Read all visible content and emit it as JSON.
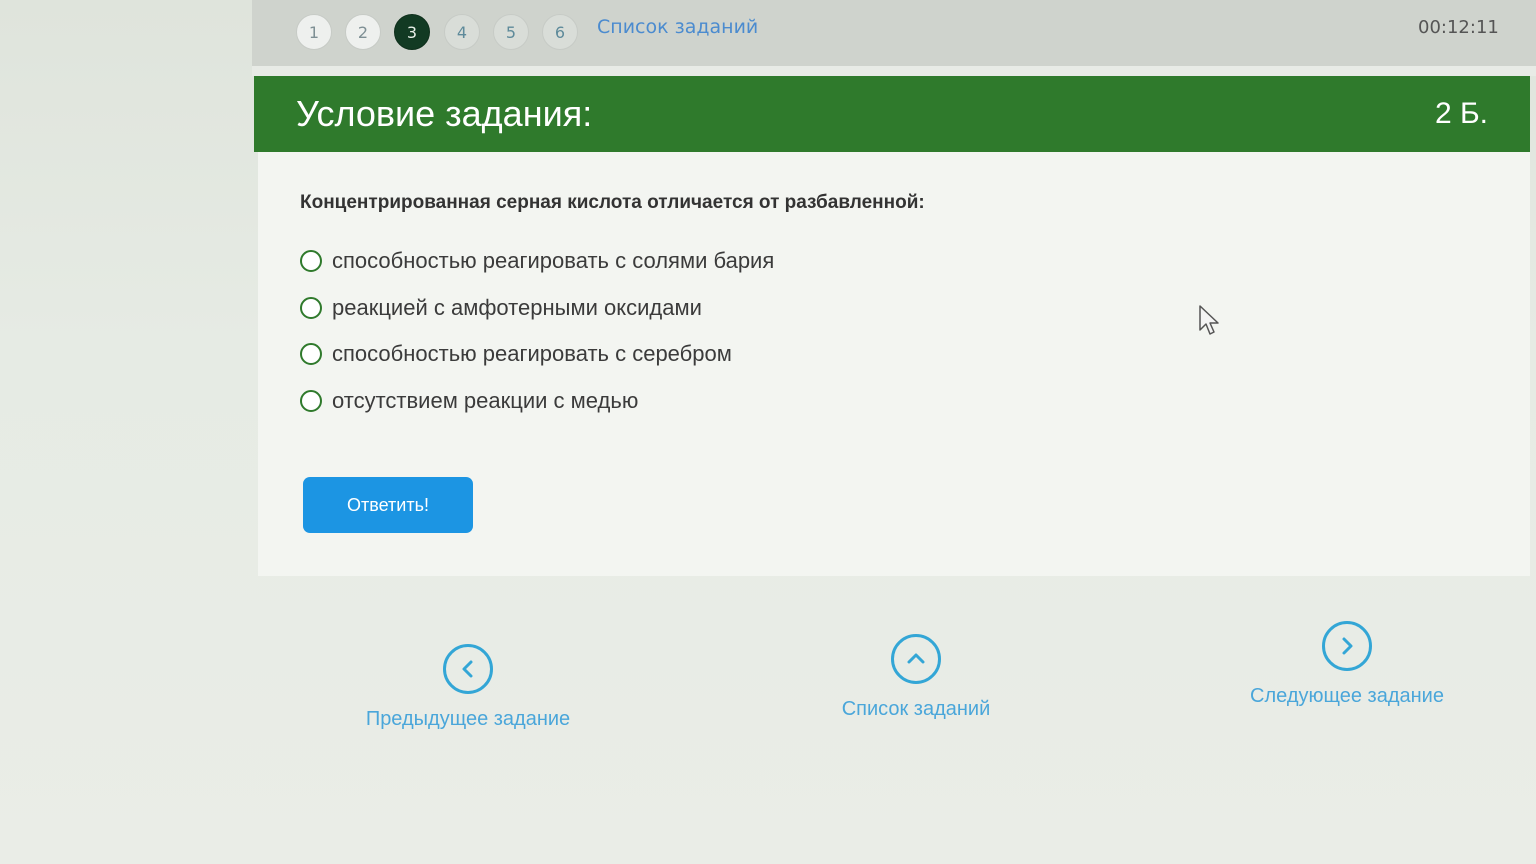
{
  "topbar": {
    "numbers": [
      {
        "label": "1",
        "state": "visited"
      },
      {
        "label": "2",
        "state": "visited"
      },
      {
        "label": "3",
        "state": "active"
      },
      {
        "label": "4",
        "state": "unvisited"
      },
      {
        "label": "5",
        "state": "unvisited"
      },
      {
        "label": "6",
        "state": "unvisited"
      }
    ],
    "task_list_link": "Список заданий",
    "timer": "00:12:11"
  },
  "header": {
    "title": "Условие задания:",
    "points": "2 Б."
  },
  "task": {
    "question": "Концентрированная серная кислота отличается от разбавленной:",
    "options": [
      "способностью реагировать с солями бария",
      "реакцией с амфотерными оксидами",
      "способностью реагировать с серебром",
      "отсутствием реакции с медью"
    ],
    "answer_button": "Ответить!"
  },
  "bottom_nav": {
    "prev": "Предыдущее задание",
    "list": "Список заданий",
    "next": "Следующее задание"
  },
  "colors": {
    "header_green": "#2f7a2c",
    "answer_blue": "#1c95e3",
    "nav_blue": "#33a6d6",
    "active_dark": "#123a23"
  },
  "icons": {
    "prev": "chevron-left-icon",
    "list": "chevron-up-icon",
    "next": "chevron-right-icon",
    "cursor": "mouse-pointer-icon"
  }
}
